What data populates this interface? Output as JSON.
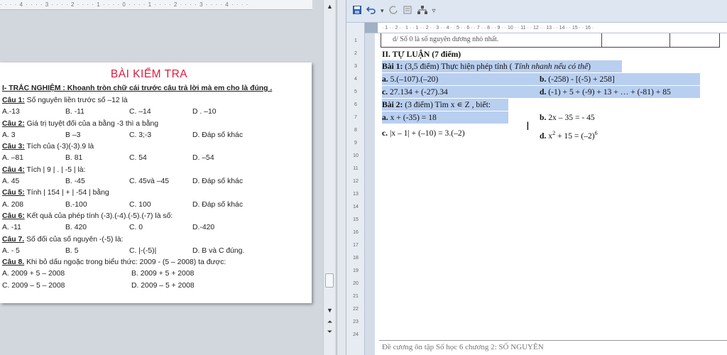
{
  "left_doc": {
    "ruler": "· · · · 4 · · · · 3 · · · · 2 · · · · 1 · · · · 0 · · · · 1 · · · · 2 · · · · 3 · · · · 4 · · · ·",
    "title": "BÀI KIỂM TRA",
    "section": "I- TRẮC NGHIỆM : Khoanh tròn chữ cái trước câu trả lời mà em cho là đúng .",
    "questions": [
      {
        "label": "Câu 1:",
        "text": " Số nguyên liền trước số –12 là",
        "options": [
          "A.-13",
          "B. -11",
          "C. –14",
          "D . –10"
        ]
      },
      {
        "label": "Câu 2:",
        "text": " Giá trị tuyệt đối của a  bằng -3 thì a bằng",
        "options": [
          "A. 3",
          "B –3",
          "C. 3;-3",
          "D.  Đáp số khác"
        ]
      },
      {
        "label": "Câu 3:",
        "text": " Tích của (-3)(-3).9  là",
        "options": [
          "A. –81",
          "B. 81",
          "C. 54",
          "D. –54"
        ]
      },
      {
        "label": "Câu 4:",
        "text": " Tích | 9 | . | -5 | là:",
        "options": [
          "A. 45",
          "B. -45",
          "C. 45và –45",
          "D. Đáp số khác"
        ]
      },
      {
        "label": "Câu 5:",
        "text": " Tính | 154 | + | -54 | bằng",
        "options": [
          "A. 208",
          "B.-100",
          "C. 100",
          "D. Đáp số khác"
        ]
      },
      {
        "label": "Câu 6:",
        "text": " Kết quả của phép tính (-3).(-4).(-5).(-7) là số:",
        "options": [
          "A.  -11",
          "B. 420",
          "C. 0",
          "D.-420"
        ]
      },
      {
        "label": "Câu 7.",
        "text": " Số đối của số nguyên -(-5) là:",
        "options": [
          "A.  - 5",
          "B. 5",
          "C. |-(-5)|",
          "D. B và C đúng."
        ]
      }
    ],
    "q8": {
      "label": "Câu 8.",
      "text": " Khi bỏ dấu ngoặc trong biểu thức: 2009 - (5 – 2008) ta được:",
      "a": "A. 2009 + 5 – 2008",
      "b": "B. 2009 + 5 + 2008",
      "c": "C. 2009 – 5 – 2008",
      "d": "D. 2009 – 5 + 2008"
    }
  },
  "right_doc": {
    "hruler": "· 1 · · 2 · · 1 · · 1 · · 2 · · 3 · · 4 · · 5 · · 6 · · 7 · · 8 · · 9 · · 10 · · 11 · · 12 · · 13 · · 14 · · 15 · · 16 ·",
    "vruler_ticks": [
      "1",
      "2",
      "3",
      "4",
      "5",
      "6",
      "7",
      "8",
      "9",
      "10",
      "11",
      "12",
      "13",
      "14",
      "15",
      "16",
      "17",
      "18",
      "19",
      "20",
      "21",
      "22",
      "23",
      "24"
    ],
    "table_text": "d/ Số 0 là số nguyên dương nhỏ nhất.",
    "part_heading": "II. TỰ LUẬN (7 điểm)",
    "bai1_label": "Bài 1:",
    "bai1_text": " (3,5 điểm) Thực hiện phép tính (",
    "bai1_hint": " Tính nhanh nếu có thể",
    "bai1_close": ")",
    "bai1_items": {
      "a_label": "a.",
      "a": " 5.(–107).(–20)",
      "b_label": "b.",
      "b": " (-258) - [(-5) + 258]",
      "c_label": "c.",
      "c": " 27.134 + (-27).34",
      "d_label": "d.",
      "d": " (-1) + 5 + (-9) + 13 + … + (-81) + 85"
    },
    "bai2_label": "Bài 2:",
    "bai2_text": " (3 điểm) Tìm x ∊ Z , biết:",
    "bai2_items": {
      "a_label": "a.",
      "a": " x + (-35) = 18",
      "b_label": "b.",
      "b": " 2x – 35 = - 45",
      "c_label": "c.",
      "c": "  |x – 1| + (–10) = 3.(–2)",
      "d_label": "d.",
      "d_base": "  x",
      "d_exp": "2",
      "d_mid": " + 15 = (–2)",
      "d_exp2": "6"
    },
    "footer": "Đề cương ôn tập Số học 6 chương 2: SỐ NGUYÊN"
  },
  "toolbar": {
    "icons": [
      "save-icon",
      "undo-icon",
      "redo-icon",
      "format-icon",
      "tree-icon",
      "customize-icon"
    ],
    "dropdown_glyph": "▾",
    "customize_glyph": "▿"
  },
  "colors": {
    "title_red": "#e0193d",
    "selection": "#b9cff0",
    "save_blue": "#2a5db0"
  }
}
